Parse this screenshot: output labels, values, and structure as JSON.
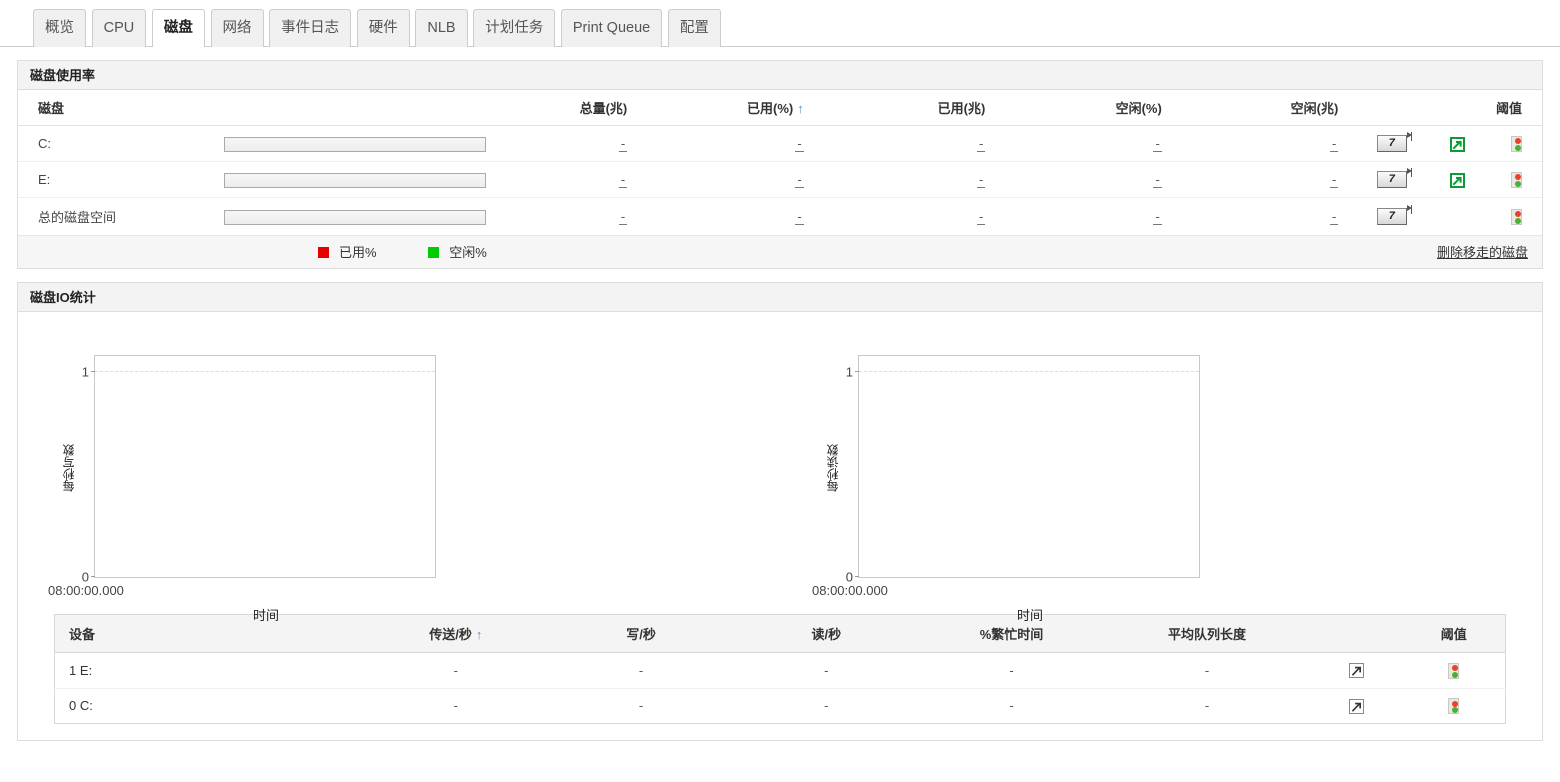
{
  "tabs": [
    {
      "label": "概览",
      "active": false
    },
    {
      "label": "CPU",
      "active": false
    },
    {
      "label": "磁盘",
      "active": true
    },
    {
      "label": "网络",
      "active": false
    },
    {
      "label": "事件日志",
      "active": false
    },
    {
      "label": "硬件",
      "active": false
    },
    {
      "label": "NLB",
      "active": false
    },
    {
      "label": "计划任务",
      "active": false
    },
    {
      "label": "Print Queue",
      "active": false
    },
    {
      "label": "配置",
      "active": false
    }
  ],
  "disk_usage": {
    "title": "磁盘使用率",
    "columns": {
      "disk": "磁盘",
      "total_mb": "总量(兆)",
      "used_pct": "已用(%)",
      "sort_indicator": "↑",
      "used_mb": "已用(兆)",
      "free_pct": "空闲(%)",
      "free_mb": "空闲(兆)",
      "threshold": "阈值"
    },
    "rows": [
      {
        "disk": "C:",
        "bar_pct": 0,
        "total_mb": "-",
        "used_pct": "-",
        "used_mb": "-",
        "free_pct": "-",
        "free_mb": "-",
        "report_label": "7",
        "has_export": true
      },
      {
        "disk": "E:",
        "bar_pct": 0,
        "total_mb": "-",
        "used_pct": "-",
        "used_mb": "-",
        "free_pct": "-",
        "free_mb": "-",
        "report_label": "7",
        "has_export": true
      },
      {
        "disk": "总的磁盘空间",
        "bar_pct": 0,
        "total_mb": "-",
        "used_pct": "-",
        "used_mb": "-",
        "free_pct": "-",
        "free_mb": "-",
        "report_label": "7",
        "has_export": false
      }
    ],
    "legend": [
      {
        "label": "已用%",
        "color": "#e60000"
      },
      {
        "label": "空闲%",
        "color": "#00cc00"
      }
    ],
    "remove_link": "删除移走的磁盘"
  },
  "disk_io": {
    "title": "磁盘IO统计",
    "table": {
      "columns": {
        "device": "设备",
        "transfers": "传送/秒",
        "sort_indicator": "↑",
        "writes": "写/秒",
        "reads": "读/秒",
        "busy": "%繁忙时间",
        "queue": "平均队列长度",
        "threshold": "阈值"
      },
      "rows": [
        {
          "device": "1 E:",
          "transfers": "-",
          "writes": "-",
          "reads": "-",
          "busy": "-",
          "queue": "-"
        },
        {
          "device": "0 C:",
          "transfers": "-",
          "writes": "-",
          "reads": "-",
          "busy": "-",
          "queue": "-"
        }
      ]
    }
  },
  "chart_data": [
    {
      "type": "line",
      "title": "",
      "xlabel": "时间",
      "ylabel": "每秒写数",
      "x": [],
      "values": [],
      "series": [],
      "xticklabels": [
        "08:00:00.000"
      ],
      "yticklabels": [
        "0",
        "1"
      ],
      "ylim": [
        0,
        1
      ],
      "grid": true,
      "legend": "none"
    },
    {
      "type": "line",
      "title": "",
      "xlabel": "时间",
      "ylabel": "每秒读数",
      "x": [],
      "values": [],
      "series": [],
      "xticklabels": [
        "08:00:00.000"
      ],
      "yticklabels": [
        "0",
        "1"
      ],
      "ylim": [
        0,
        1
      ],
      "grid": true,
      "legend": "none"
    }
  ]
}
